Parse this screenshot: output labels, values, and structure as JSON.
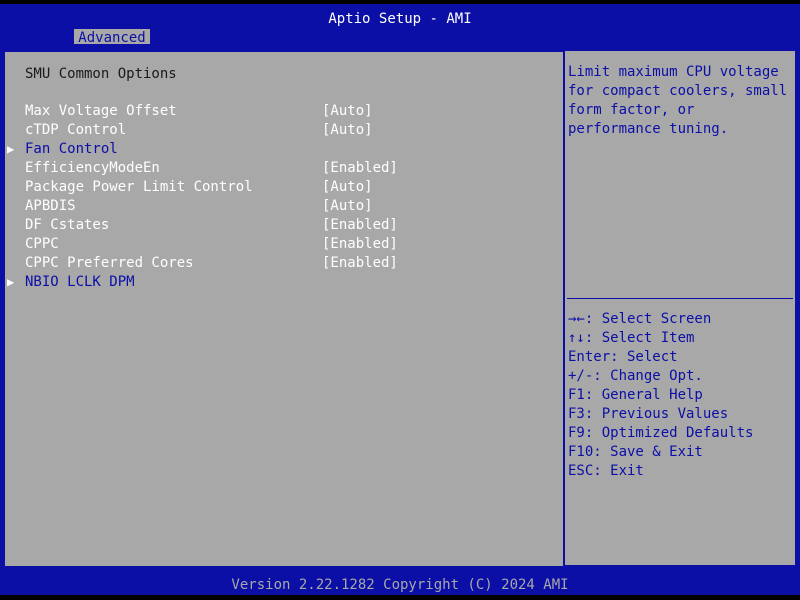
{
  "header": {
    "title": "Aptio Setup - AMI",
    "active_tab": "Advanced"
  },
  "main": {
    "section_title": "SMU Common Options",
    "settings": [
      {
        "label": "Max Voltage Offset",
        "value": "[Auto]",
        "submenu": false
      },
      {
        "label": "cTDP Control",
        "value": "[Auto]",
        "submenu": false
      },
      {
        "label": "Fan Control",
        "value": "",
        "submenu": true
      },
      {
        "label": "EfficiencyModeEn",
        "value": "[Enabled]",
        "submenu": false
      },
      {
        "label": "Package Power Limit Control",
        "value": "[Auto]",
        "submenu": false
      },
      {
        "label": "APBDIS",
        "value": "[Auto]",
        "submenu": false
      },
      {
        "label": "DF Cstates",
        "value": "[Enabled]",
        "submenu": false
      },
      {
        "label": "CPPC",
        "value": "[Enabled]",
        "submenu": false
      },
      {
        "label": "CPPC Preferred Cores",
        "value": "[Enabled]",
        "submenu": false
      },
      {
        "label": "NBIO LCLK DPM",
        "value": "",
        "submenu": true
      }
    ],
    "submenu_arrow": "▶"
  },
  "help": {
    "lines": [
      "Limit maximum CPU voltage",
      "for compact coolers, small",
      "form factor, or",
      "performance tuning."
    ]
  },
  "keys": [
    "→←: Select Screen",
    "↑↓: Select Item",
    "Enter: Select",
    "+/-: Change Opt.",
    "F1: General Help",
    "F3: Previous Values",
    "F9: Optimized Defaults",
    "F10: Save & Exit",
    "ESC: Exit"
  ],
  "footer": {
    "text": "Version 2.22.1282 Copyright (C) 2024 AMI"
  },
  "colors": {
    "bios_blue": "#0b0fa6",
    "panel_gray": "#a8a8a8",
    "text_white": "#ffffff",
    "text_dark": "#1a1a1a"
  }
}
